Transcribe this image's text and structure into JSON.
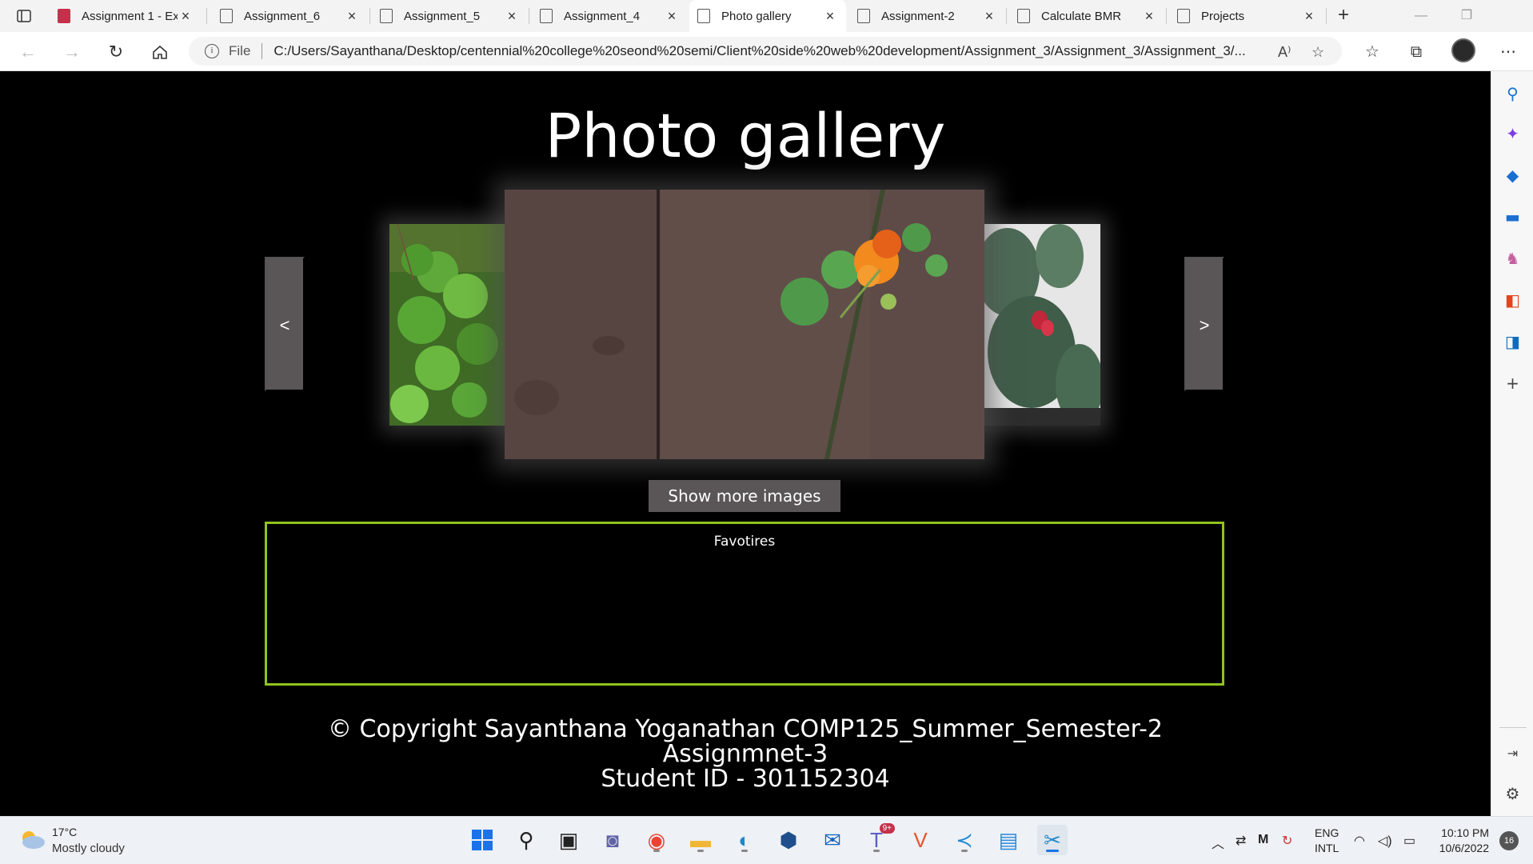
{
  "browser": {
    "tabs": [
      {
        "title": "Assignment 1 - Ex",
        "icon": "pdf-icon"
      },
      {
        "title": "Assignment_6",
        "icon": "file-icon"
      },
      {
        "title": "Assignment_5",
        "icon": "file-icon"
      },
      {
        "title": "Assignment_4",
        "icon": "file-icon"
      },
      {
        "title": "Photo gallery",
        "icon": "file-icon",
        "active": true
      },
      {
        "title": "Assignment-2",
        "icon": "file-icon"
      },
      {
        "title": "Calculate BMR",
        "icon": "file-icon"
      },
      {
        "title": "Projects",
        "icon": "file-icon"
      }
    ],
    "address": {
      "scheme": "File",
      "url": "C:/Users/Sayanthana/Desktop/centennial%20college%20seond%20semi/Client%20side%20web%20development/Assignment_3/Assignment_3/Assignment_3/..."
    }
  },
  "page": {
    "title": "Photo gallery",
    "prev_label": "<",
    "next_label": ">",
    "show_more_label": "Show more images",
    "favorites_title": "Favotires",
    "footer": {
      "line1": "© Copyright Sayanthana Yoganathan COMP125_Summer_Semester-2",
      "line2": "Assignmnet-3",
      "line3": "Student ID - 301152304"
    },
    "colors": {
      "background": "#000000",
      "button": "#5a5657",
      "favorites_border": "#8fc31f"
    }
  },
  "taskbar": {
    "weather_temp": "17°C",
    "weather_desc": "Mostly cloudy",
    "lang_line1": "ENG",
    "lang_line2": "INTL",
    "time": "10:10 PM",
    "date": "10/6/2022",
    "notifications": "16",
    "teams_badge": "9+"
  }
}
